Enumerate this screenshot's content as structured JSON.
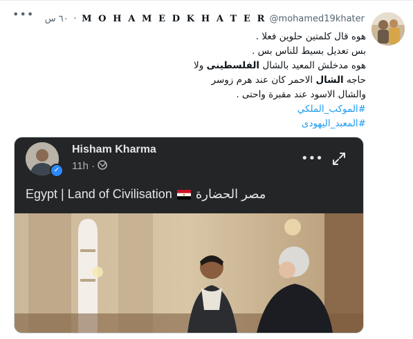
{
  "tweet": {
    "display_name": "M O H A M E D K H A T E R",
    "handle": "@mohamed19khater",
    "separator": "·",
    "time": "٦٠ س",
    "more_icon": "more-horizontal-icon",
    "lines": [
      "هوه قال كلمتين حلوين فعلا .",
      "بس تعديل بسيط للناس بس ."
    ],
    "line3_a": "هوه مدخلش المعيد بالشال ",
    "line3_bold1": "الفلسطينى",
    "line3_b": " ولا حاجه ",
    "line3_bold2": "الشال",
    "line3_c": " الاحمر كان عند هرم زوسر",
    "line4": "والشال الاسود عند مقبرة واحتى .",
    "hashtags": [
      "#الموكب_الملكي",
      "#المعبد_اليهودى"
    ]
  },
  "embed": {
    "name": "Hisham Kharma",
    "time": "11h",
    "dot": "·",
    "caption_en": "Egypt | Land of Civilisation",
    "caption_ar": "مصر الحضارة",
    "more_icon": "more-dots-icon",
    "expand_icon": "expand-icon",
    "globe_icon": "globe-icon"
  }
}
